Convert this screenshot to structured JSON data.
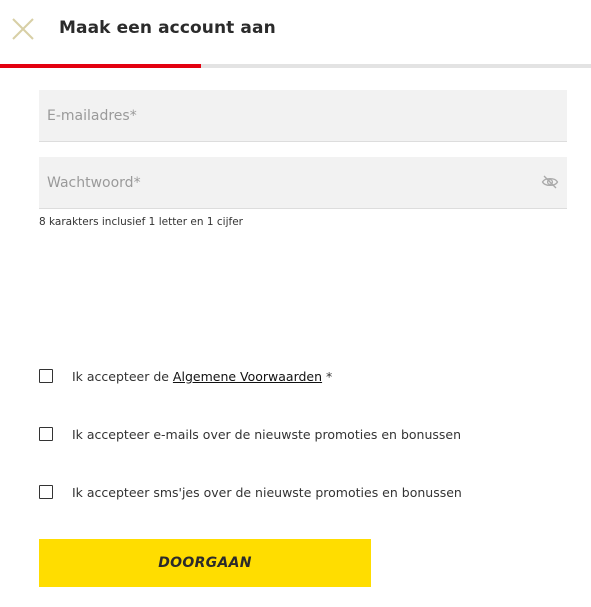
{
  "header": {
    "title": "Maak een account aan",
    "close_icon": "close-icon"
  },
  "progress": {
    "fraction": 0.34,
    "fill_color": "#e3000f",
    "track_color": "#e3e3e3"
  },
  "form": {
    "email": {
      "placeholder": "E-mailadres*",
      "value": ""
    },
    "password": {
      "placeholder": "Wachtwoord*",
      "value": "",
      "toggle_icon": "eye-off-icon",
      "hint": "8 karakters inclusief 1 letter en 1 cijfer"
    },
    "consents": [
      {
        "prefix": "Ik accepteer de ",
        "link": "Algemene Voorwaarden",
        "suffix": " *",
        "checked": false
      },
      {
        "text": "Ik accepteer e-mails over de nieuwste promoties en bonussen",
        "checked": false
      },
      {
        "text": "Ik accepteer sms'jes over de nieuwste promoties en bonussen",
        "checked": false
      }
    ],
    "submit_label": "DOORGAAN"
  },
  "colors": {
    "accent_yellow": "#ffdd00",
    "accent_red": "#e3000f",
    "close_icon": "#d8cfa6"
  }
}
